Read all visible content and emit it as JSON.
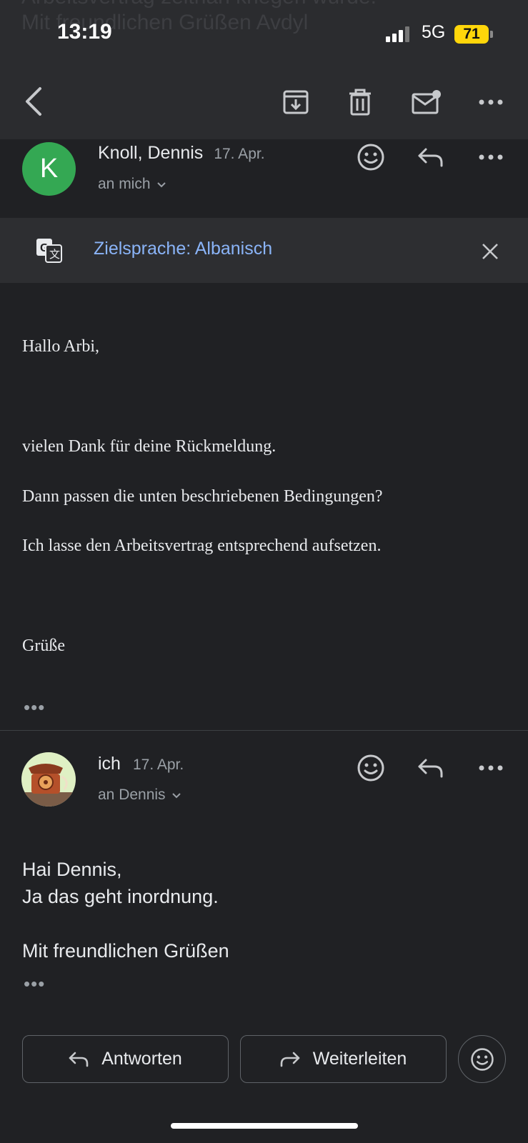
{
  "status_bar": {
    "time": "13:19",
    "network": "5G",
    "battery": "71"
  },
  "ghost_text": {
    "line1": "Arbeitsvertrag zeitnah kriegen würde.",
    "line2": "Mit freundlichen Grüßen Avdyl"
  },
  "toolbar": {
    "back_icon": "back-arrow-icon",
    "archive_icon": "archive-icon",
    "delete_icon": "trash-icon",
    "mark_unread_icon": "mark-unread-icon",
    "more_icon": "more-horizontal-icon"
  },
  "message1": {
    "avatar_letter": "K",
    "avatar_color": "#34a853",
    "sender": "Knoll, Dennis",
    "date": "17. Apr.",
    "recipient": "an mich",
    "body": {
      "greeting": "Hallo Arbi,",
      "line1": "vielen Dank für deine Rückmeldung.",
      "line2": "Dann passen die unten beschriebenen Bedingungen?",
      "line3": "Ich lasse den Arbeitsvertrag entsprechend aufsetzen.",
      "closing": "Grüße"
    },
    "trimmed": "•••"
  },
  "translate_bar": {
    "label": "Zielsprache: Albanisch",
    "accent": "#8ab4f8"
  },
  "message2": {
    "sender": "ich",
    "date": "17. Apr.",
    "recipient": "an Dennis",
    "body": {
      "line1": "Hai Dennis,",
      "line2": "Ja das geht inordnung.",
      "line3": "Mit freundlichen Grüßen"
    },
    "trimmed": "•••"
  },
  "actions": {
    "reply": "Antworten",
    "forward": "Weiterleiten"
  }
}
